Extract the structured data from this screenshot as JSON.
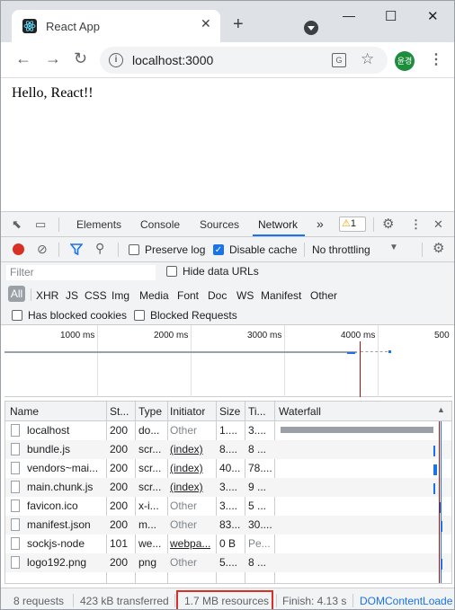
{
  "browser": {
    "tab_title": "React App",
    "url": "localhost:3000",
    "avatar_text": "윤경"
  },
  "page": {
    "heading": "Hello, React!!"
  },
  "devtools": {
    "tabs": [
      "Elements",
      "Console",
      "Sources",
      "Network"
    ],
    "more": "»",
    "warnings": "1",
    "preserve_log": "Preserve log",
    "disable_cache": "Disable cache",
    "throttling": "No throttling",
    "filter_placeholder": "Filter",
    "hide_data_urls": "Hide data URLs",
    "types": [
      "All",
      "XHR",
      "JS",
      "CSS",
      "Img",
      "Media",
      "Font",
      "Doc",
      "WS",
      "Manifest",
      "Other"
    ],
    "has_blocked_cookies": "Has blocked cookies",
    "blocked_requests": "Blocked Requests",
    "overview_ticks": [
      "1000 ms",
      "2000 ms",
      "3000 ms",
      "4000 ms",
      "500"
    ],
    "columns": [
      "Name",
      "St...",
      "Type",
      "Initiator",
      "Size",
      "Ti...",
      "Waterfall"
    ],
    "rows": [
      {
        "name": "localhost",
        "status": "200",
        "type": "do...",
        "initiator": "Other",
        "size": "1....",
        "time": "3...."
      },
      {
        "name": "bundle.js",
        "status": "200",
        "type": "scr...",
        "initiator": "(index)",
        "size": "8....",
        "time": "8 ..."
      },
      {
        "name": "vendors~mai...",
        "status": "200",
        "type": "scr...",
        "initiator": "(index)",
        "size": "40...",
        "time": "78...."
      },
      {
        "name": "main.chunk.js",
        "status": "200",
        "type": "scr...",
        "initiator": "(index)",
        "size": "3....",
        "time": "9 ..."
      },
      {
        "name": "favicon.ico",
        "status": "200",
        "type": "x-i...",
        "initiator": "Other",
        "size": "3....",
        "time": "5 ..."
      },
      {
        "name": "manifest.json",
        "status": "200",
        "type": "m...",
        "initiator": "Other",
        "size": "83...",
        "time": "30...."
      },
      {
        "name": "sockjs-node",
        "status": "101",
        "type": "we...",
        "initiator": "webpa...",
        "size": "0 B",
        "time": "Pe..."
      },
      {
        "name": "logo192.png",
        "status": "200",
        "type": "png",
        "initiator": "Other",
        "size": "5....",
        "time": "8 ..."
      }
    ],
    "status": {
      "requests": "8 requests",
      "transferred": "423 kB transferred",
      "resources": "1.7 MB resources",
      "finish": "Finish: 4.13 s",
      "dcl": "DOMContentLoade"
    }
  },
  "colors": {
    "accent": "#1a73e8",
    "record": "#d93025",
    "highlight_border": "#d93025"
  }
}
